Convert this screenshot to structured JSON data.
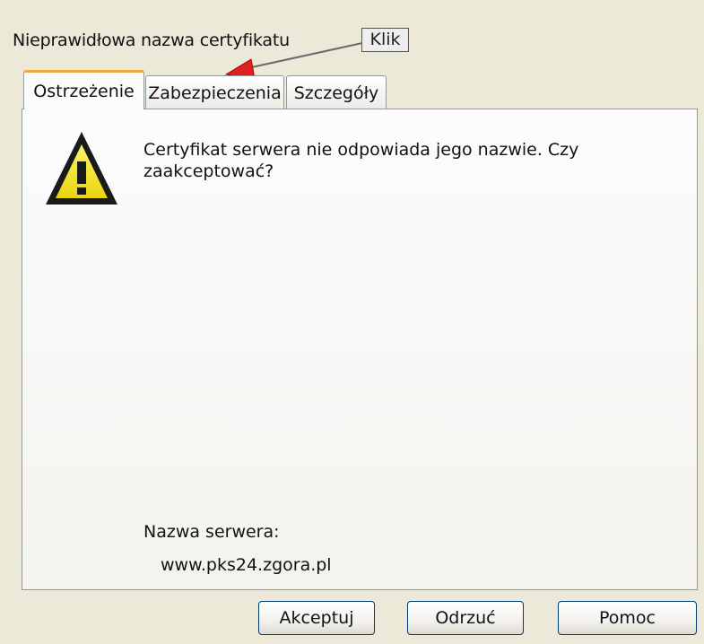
{
  "dialog": {
    "title": "Nieprawidłowa nazwa certyfikatu",
    "callout_label": "Klik"
  },
  "tabs": [
    {
      "label": "Ostrzeżenie",
      "active": true
    },
    {
      "label": "Zabezpieczenia",
      "active": false
    },
    {
      "label": "Szczegóły",
      "active": false
    }
  ],
  "warning": {
    "icon": "warning-triangle-icon",
    "message": "Certyfikat serwera nie odpowiada jego nazwie. Czy zaakceptować?",
    "server_label": "Nazwa serwera:",
    "server_value": "www.pks24.zgora.pl"
  },
  "buttons": {
    "accept": "Akceptuj",
    "reject": "Odrzuć",
    "help": "Pomoc"
  },
  "colors": {
    "dialog_bg": "#ece9d8",
    "active_tab_accent": "#f1a83b",
    "arrow": "#e02020",
    "icon_yellow": "#f5e62a"
  }
}
